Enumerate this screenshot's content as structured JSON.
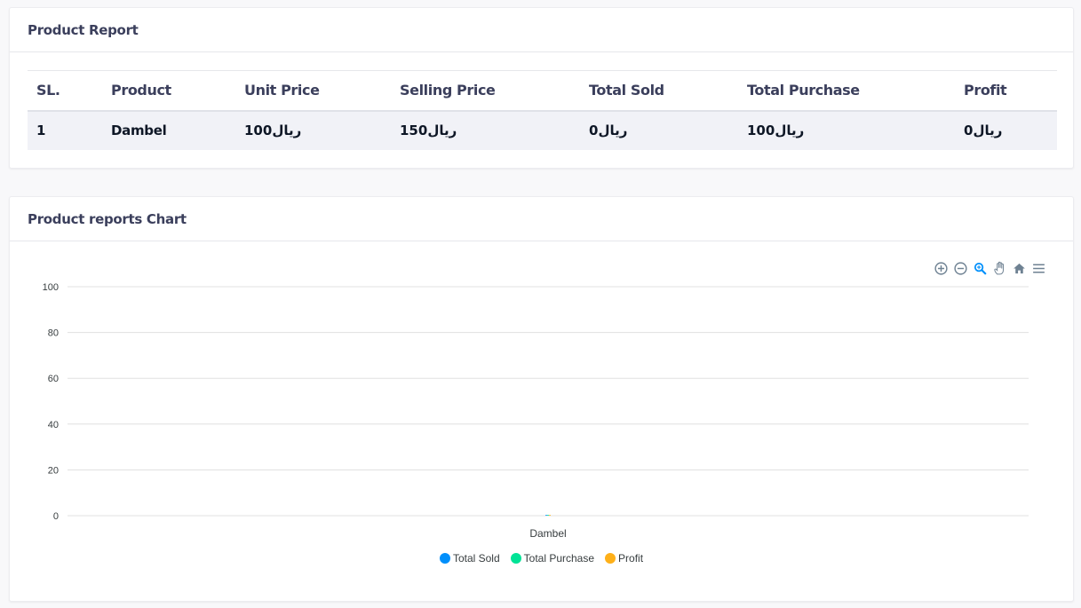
{
  "report": {
    "title": "Product Report",
    "columns": [
      "SL.",
      "Product",
      "Unit Price",
      "Selling Price",
      "Total Sold",
      "Total Purchase",
      "Profit"
    ],
    "rows": [
      [
        "1",
        "Dambel",
        "100ريال",
        "150ريال",
        "0ريال",
        "100ريال",
        "0ريال"
      ]
    ]
  },
  "chart_section": {
    "title": "Product reports Chart",
    "toolbar": [
      "zoom-in-icon",
      "zoom-out-icon",
      "zoom-select-icon",
      "pan-hand-icon",
      "home-reset-icon",
      "menu-icon"
    ]
  },
  "chart_data": {
    "type": "bar",
    "categories": [
      "Dambel"
    ],
    "series": [
      {
        "name": "Total Sold",
        "values": [
          0
        ],
        "color": "#008ffb"
      },
      {
        "name": "Total Purchase",
        "values": [
          0
        ],
        "color": "#00e396"
      },
      {
        "name": "Profit",
        "values": [
          0
        ],
        "color": "#feb019"
      }
    ],
    "ylim": [
      0,
      100
    ],
    "yticks": [
      "100",
      "80",
      "60",
      "40",
      "20",
      "0"
    ],
    "title": "",
    "xlabel": "",
    "ylabel": "",
    "grid": true,
    "legend": "bottom-center"
  }
}
